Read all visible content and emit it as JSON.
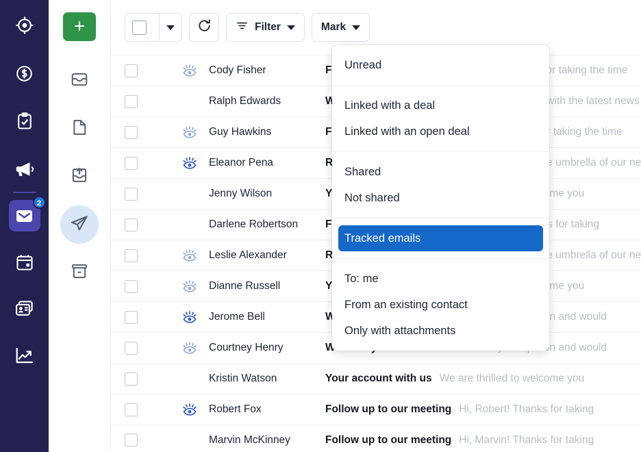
{
  "rail": {
    "items": [
      {
        "name": "target-icon",
        "label": "Leads"
      },
      {
        "name": "dollar-circle-icon",
        "label": "Deals"
      },
      {
        "name": "clipboard-check-icon",
        "label": "Activities"
      },
      {
        "name": "megaphone-icon",
        "label": "Campaigns"
      },
      {
        "name": "mail-icon",
        "label": "Mail",
        "badge": "2",
        "active": true
      },
      {
        "name": "calendar-icon",
        "label": "Calendar"
      },
      {
        "name": "contact-cards-icon",
        "label": "Contacts"
      },
      {
        "name": "analytics-chart-icon",
        "label": "Insights"
      }
    ],
    "active_badge": "2",
    "active_color": "#4b45ae",
    "background": "#232150",
    "badge_color": "#1f7ae0"
  },
  "folders": {
    "compose": {
      "label": "+",
      "color": "#2e9448"
    },
    "items": [
      {
        "name": "inbox-icon",
        "label": "Inbox"
      },
      {
        "name": "drafts-document-icon",
        "label": "Drafts"
      },
      {
        "name": "outbox-upload-icon",
        "label": "Outbox"
      },
      {
        "name": "sent-paper-plane-icon",
        "label": "Sent",
        "active": true
      },
      {
        "name": "archive-box-icon",
        "label": "Archive"
      }
    ],
    "active_bg": "#d9e6f7"
  },
  "toolbar": {
    "select_all_label": "",
    "refresh_label": "",
    "filter_label": "Filter",
    "mark_label": "Mark"
  },
  "filter_menu": {
    "highlight_color": "#1567c8",
    "groups": [
      {
        "items": [
          {
            "label": "Unread",
            "selected": false
          }
        ]
      },
      {
        "items": [
          {
            "label": "Linked with a deal",
            "selected": false
          },
          {
            "label": "Linked with an open deal",
            "selected": false
          }
        ]
      },
      {
        "items": [
          {
            "label": "Shared",
            "selected": false
          },
          {
            "label": "Not shared",
            "selected": false
          }
        ]
      },
      {
        "items": [
          {
            "label": "Tracked emails",
            "selected": true
          }
        ]
      },
      {
        "items": [
          {
            "label": "To: me",
            "selected": false
          },
          {
            "label": "From an existing contact",
            "selected": false
          },
          {
            "label": "Only with attachments",
            "selected": false
          }
        ]
      }
    ]
  },
  "email_list": {
    "rows": [
      {
        "sender": "Cody Fisher",
        "tracked": true,
        "tracked_shade": "light",
        "subject": "Follow up to our meeting",
        "preview": "Hi, Cody! Thanks for taking the time"
      },
      {
        "sender": "Ralph Edwards",
        "tracked": false,
        "tracked_shade": "",
        "subject": "Welcome to our mailing list",
        "preview": "Stay connected with the latest news"
      },
      {
        "sender": "Guy Hawkins",
        "tracked": true,
        "tracked_shade": "light",
        "subject": "Follow up to our meeting",
        "preview": "Hi, Guy! Thanks for taking the time"
      },
      {
        "sender": "Eleanor Pena",
        "tracked": true,
        "tracked_shade": "dark",
        "subject": "Request for a Pitch Meeting Today",
        "preview": "Under the umbrella of our new"
      },
      {
        "sender": "Jenny Wilson",
        "tracked": false,
        "tracked_shade": "",
        "subject": "Your account with us",
        "preview": "We are thrilled to welcome you"
      },
      {
        "sender": "Darlene Robertson",
        "tracked": false,
        "tracked_shade": "",
        "subject": "Follow up to our meeting",
        "preview": "Hi, Darlene! Thanks for taking"
      },
      {
        "sender": "Leslie Alexander",
        "tracked": true,
        "tracked_shade": "light",
        "subject": "Request for a Pitch Meeting Today",
        "preview": "Under the umbrella of our new"
      },
      {
        "sender": "Dianne Russell",
        "tracked": true,
        "tracked_shade": "light",
        "subject": "Your account with us",
        "preview": "We are thrilled to welcome you"
      },
      {
        "sender": "Jerome Bell",
        "tracked": true,
        "tracked_shade": "dark",
        "subject": "We want your feedback",
        "preview": "We value your opinion and would"
      },
      {
        "sender": "Courtney Henry",
        "tracked": true,
        "tracked_shade": "light",
        "subject": "We want your feedback",
        "preview": "We value your opinion and would"
      },
      {
        "sender": "Kristin Watson",
        "tracked": false,
        "tracked_shade": "",
        "subject": "Your account with us",
        "preview": "We are thrilled to welcome you"
      },
      {
        "sender": "Robert Fox",
        "tracked": true,
        "tracked_shade": "dark",
        "subject": "Follow up to our meeting",
        "preview": "Hi, Robert! Thanks for taking"
      },
      {
        "sender": "Marvin McKinney",
        "tracked": false,
        "tracked_shade": "",
        "subject": "Follow up to our meeting",
        "preview": "Hi, Marvin! Thanks for taking"
      }
    ]
  }
}
